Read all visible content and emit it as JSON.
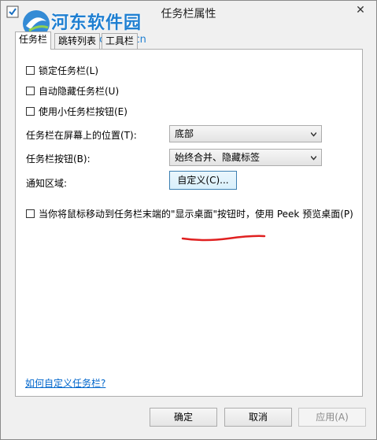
{
  "window": {
    "title": "任务栏属性",
    "close_glyph": "✕"
  },
  "watermark": {
    "title": "河东软件园",
    "url": "www.pc0359.cn"
  },
  "tabs": [
    {
      "label": "任务栏"
    },
    {
      "label": "跳转列表"
    },
    {
      "label": "工具栏"
    }
  ],
  "options": {
    "lock": "锁定任务栏(L)",
    "autohide": "自动隐藏任务栏(U)",
    "small_buttons": "使用小任务栏按钮(E)",
    "location_label": "任务栏在屏幕上的位置(T):",
    "location_value": "底部",
    "buttons_label": "任务栏按钮(B):",
    "buttons_value": "始终合并、隐藏标签",
    "notify_label": "通知区域:",
    "customize_button": "自定义(C)...",
    "peek": "当你将鼠标移动到任务栏末端的\"显示桌面\"按钮时，使用 Peek 预览桌面(P)",
    "help_link": "如何自定义任务栏?"
  },
  "footer": {
    "ok": "确定",
    "cancel": "取消",
    "apply": "应用(A)"
  },
  "colors": {
    "accent": "#1f7fd1",
    "link": "#0066cc",
    "annotation": "#e02020"
  },
  "icons": [
    "app-icon",
    "close-icon",
    "chevron-down-icon",
    "watermark-logo-icon"
  ]
}
